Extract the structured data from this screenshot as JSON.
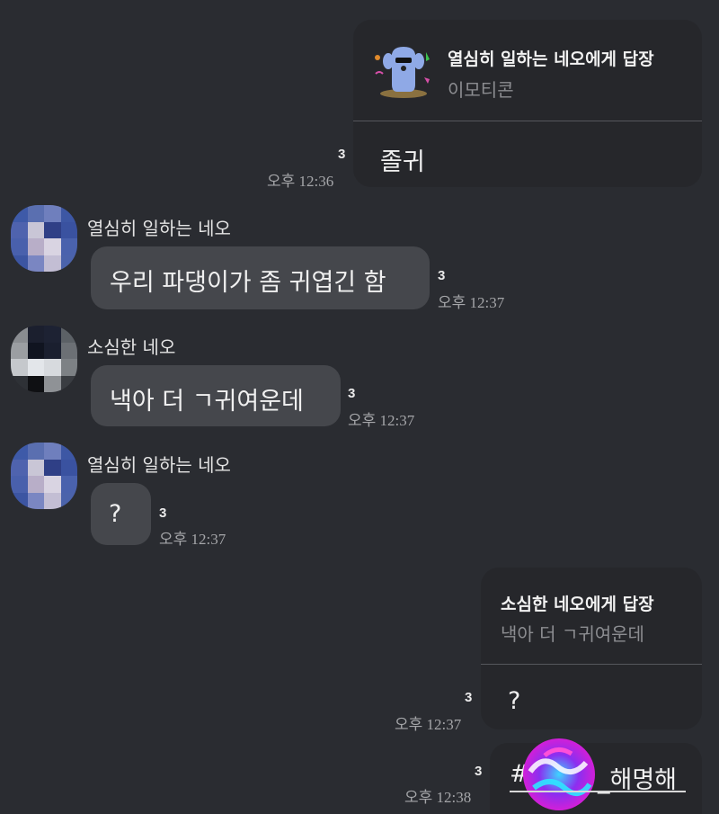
{
  "messages": [
    {
      "reply_title": "열심히 일하는 네오에게 답장",
      "reply_sub": "이모티콘",
      "text": "졸귀",
      "unread": "3",
      "time": "오후 12:36"
    },
    {
      "sender": "열심히 일하는 네오",
      "text": "우리 파댕이가 좀 귀엽긴 함",
      "unread": "3",
      "time": "오후 12:37"
    },
    {
      "sender": "소심한 네오",
      "text": "낵아 더 ㄱ귀여운데",
      "unread": "3",
      "time": "오후 12:37"
    },
    {
      "sender": "열심히 일하는 네오",
      "text": "?",
      "unread": "3",
      "time": "오후 12:37"
    },
    {
      "reply_title": "소심한 네오에게 답장",
      "reply_sub": "낵아 더 ㄱ귀여운데",
      "text": "?",
      "unread": "3",
      "time": "오후 12:37"
    },
    {
      "text_prefix": "#",
      "text_suffix": "_해명해",
      "unread": "3",
      "time": "오후 12:38"
    }
  ],
  "icons": {
    "emoticon": "dancing-dog-emoticon",
    "avatar_a": "pixelated-avatar",
    "avatar_b": "pixelated-avatar",
    "inline_emoji": "swirl-emoji"
  },
  "colors": {
    "background": "#2a2c31",
    "bubble": "#45474c",
    "my_reply_bubble": "#26272b"
  }
}
